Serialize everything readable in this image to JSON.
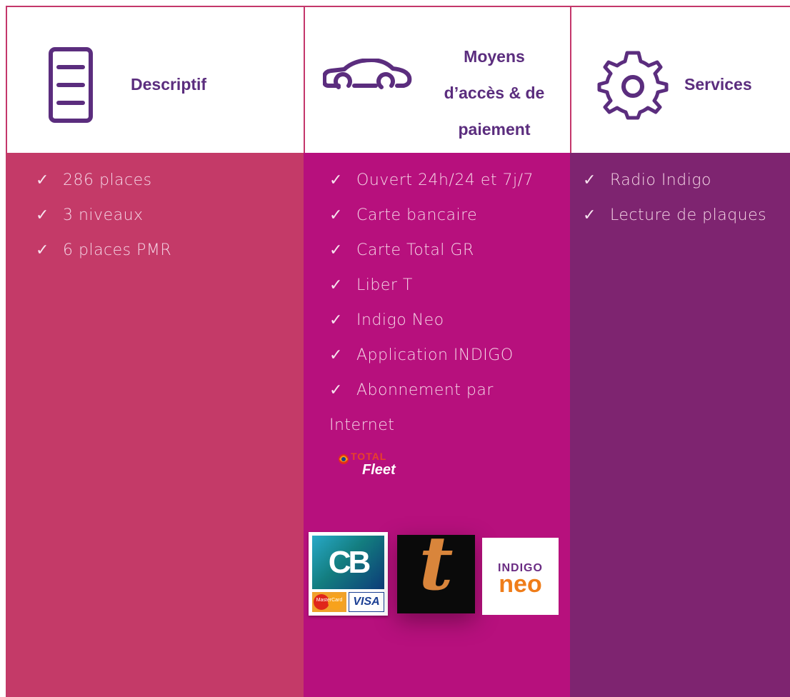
{
  "columns": [
    {
      "title": "Descriptif",
      "icon": "document-icon",
      "items": [
        "286 places",
        "3 niveaux",
        "6 places PMR"
      ]
    },
    {
      "title_lines": [
        "Moyens",
        "d’accès & de",
        "paiement"
      ],
      "icon": "car-icon",
      "items": [
        "Ouvert 24h/24 et 7j/7",
        "Carte bancaire",
        "Carte Total GR",
        "Liber T",
        "Indigo Neo",
        "Application INDIGO",
        "Abonnement par Internet"
      ]
    },
    {
      "title": "Services",
      "icon": "gear-icon",
      "items": [
        "Radio Indigo",
        "Lecture de plaques"
      ]
    }
  ],
  "check_mark": "✓",
  "logos": {
    "total_fleet": {
      "line1": "TOTAL",
      "line2": "Fleet"
    },
    "cb": {
      "label": "CB",
      "mastercard": "MasterCard",
      "visa": "VISA"
    },
    "liber_t": {
      "label": "t"
    },
    "indigo_neo": {
      "line1": "INDIGO",
      "line2": "neo"
    }
  },
  "colors": {
    "border": "#c4376b",
    "header_text": "#5b2d7e",
    "col1_bg": "#c43a68",
    "col2_bg": "#b7107d",
    "col3_bg": "#7e2470",
    "item_text": "#f5d6e6"
  }
}
